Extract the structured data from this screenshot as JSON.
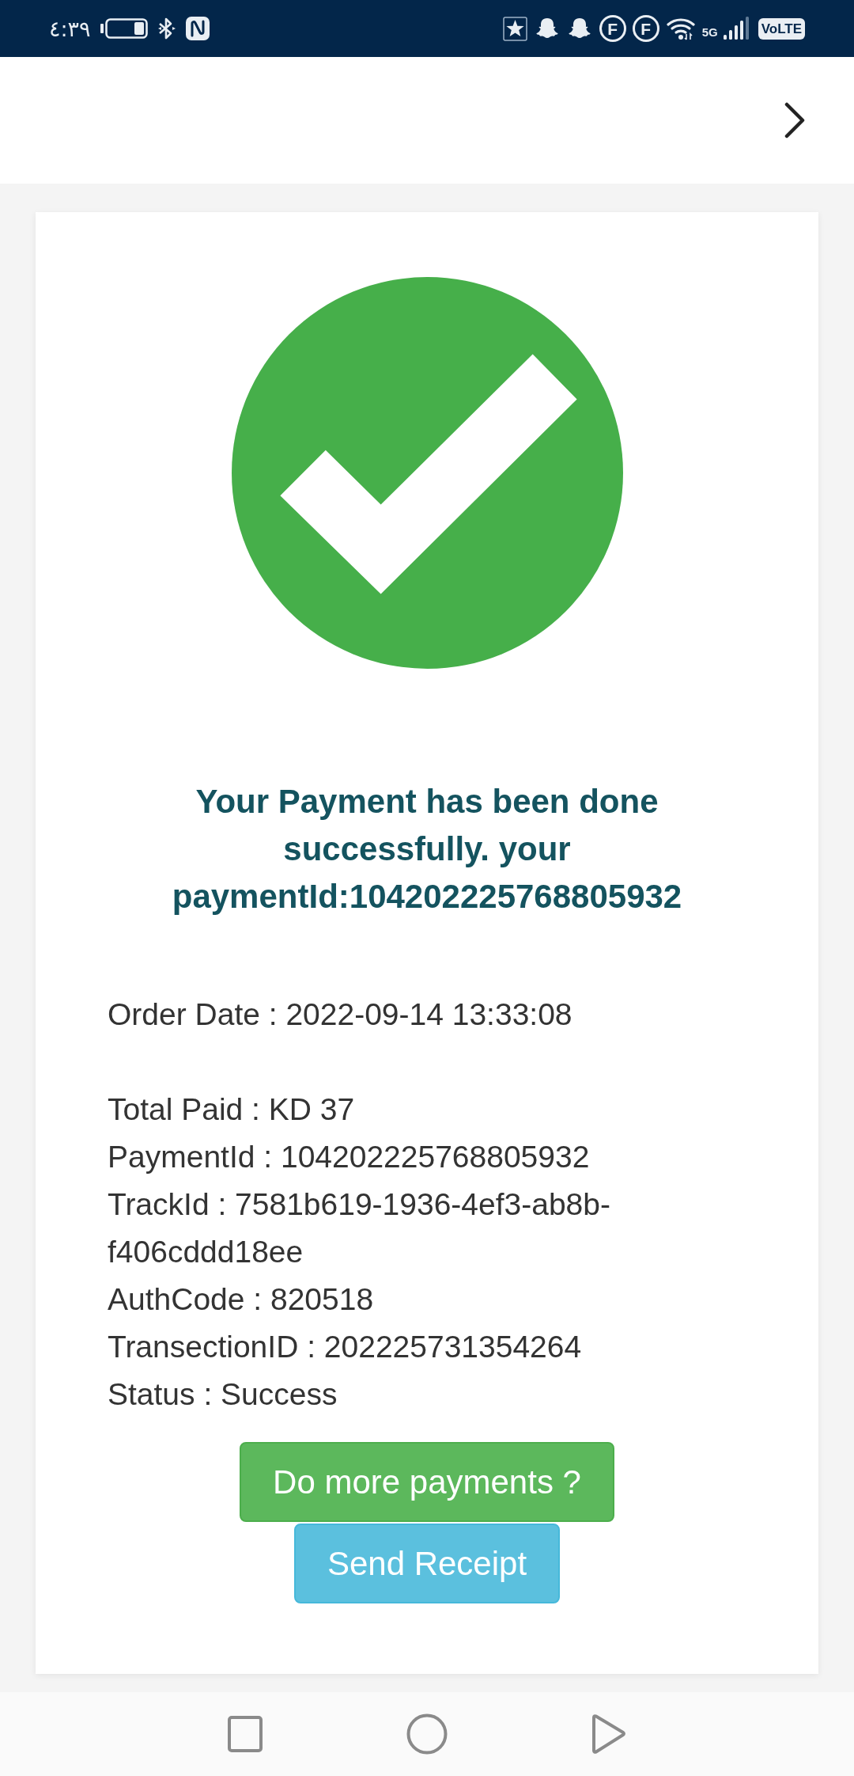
{
  "status_bar": {
    "time": "٤:٣٩",
    "app_badges": [
      "F",
      "F"
    ],
    "network_type": "5G",
    "volte": "VoLTE"
  },
  "receipt": {
    "message": "Your Payment has been done successfully. your paymentId:104202225768805932",
    "order_date": "Order Date : 2022-09-14 13:33:08",
    "details": [
      "Total Paid : KD 37",
      "PaymentId : 104202225768805932",
      "TrackId : 7581b619-1936-4ef3-ab8b-f406cddd18ee",
      "AuthCode : 820518",
      "TransectionID : 202225731354264",
      "Status : Success"
    ],
    "buttons": [
      {
        "label": "Do more payments ?",
        "kind": "success"
      },
      {
        "label": "Send Receipt",
        "kind": "info"
      }
    ]
  }
}
